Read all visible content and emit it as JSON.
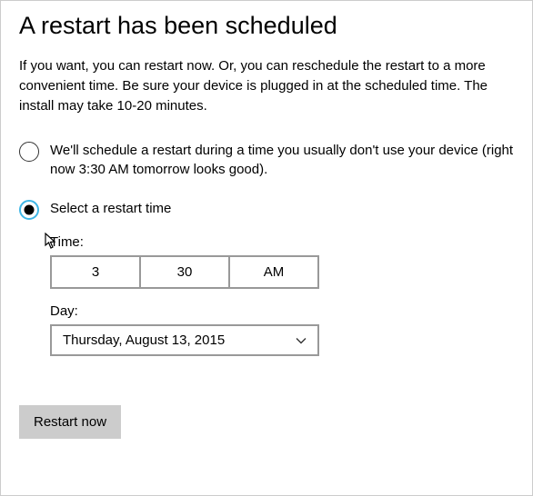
{
  "title": "A restart has been scheduled",
  "description": "If you want, you can restart now. Or, you can reschedule the restart to a more convenient time. Be sure your device is plugged in at the scheduled time. The install may take 10-20 minutes.",
  "option_auto": "We'll schedule a restart during a time you usually don't use your device (right now 3:30 AM tomorrow looks good).",
  "option_manual": "Select a restart time",
  "time_label": "Time:",
  "time_hour": "3",
  "time_minute": "30",
  "time_period": "AM",
  "day_label": "Day:",
  "day_value": "Thursday, August 13, 2015",
  "restart_button": "Restart now"
}
